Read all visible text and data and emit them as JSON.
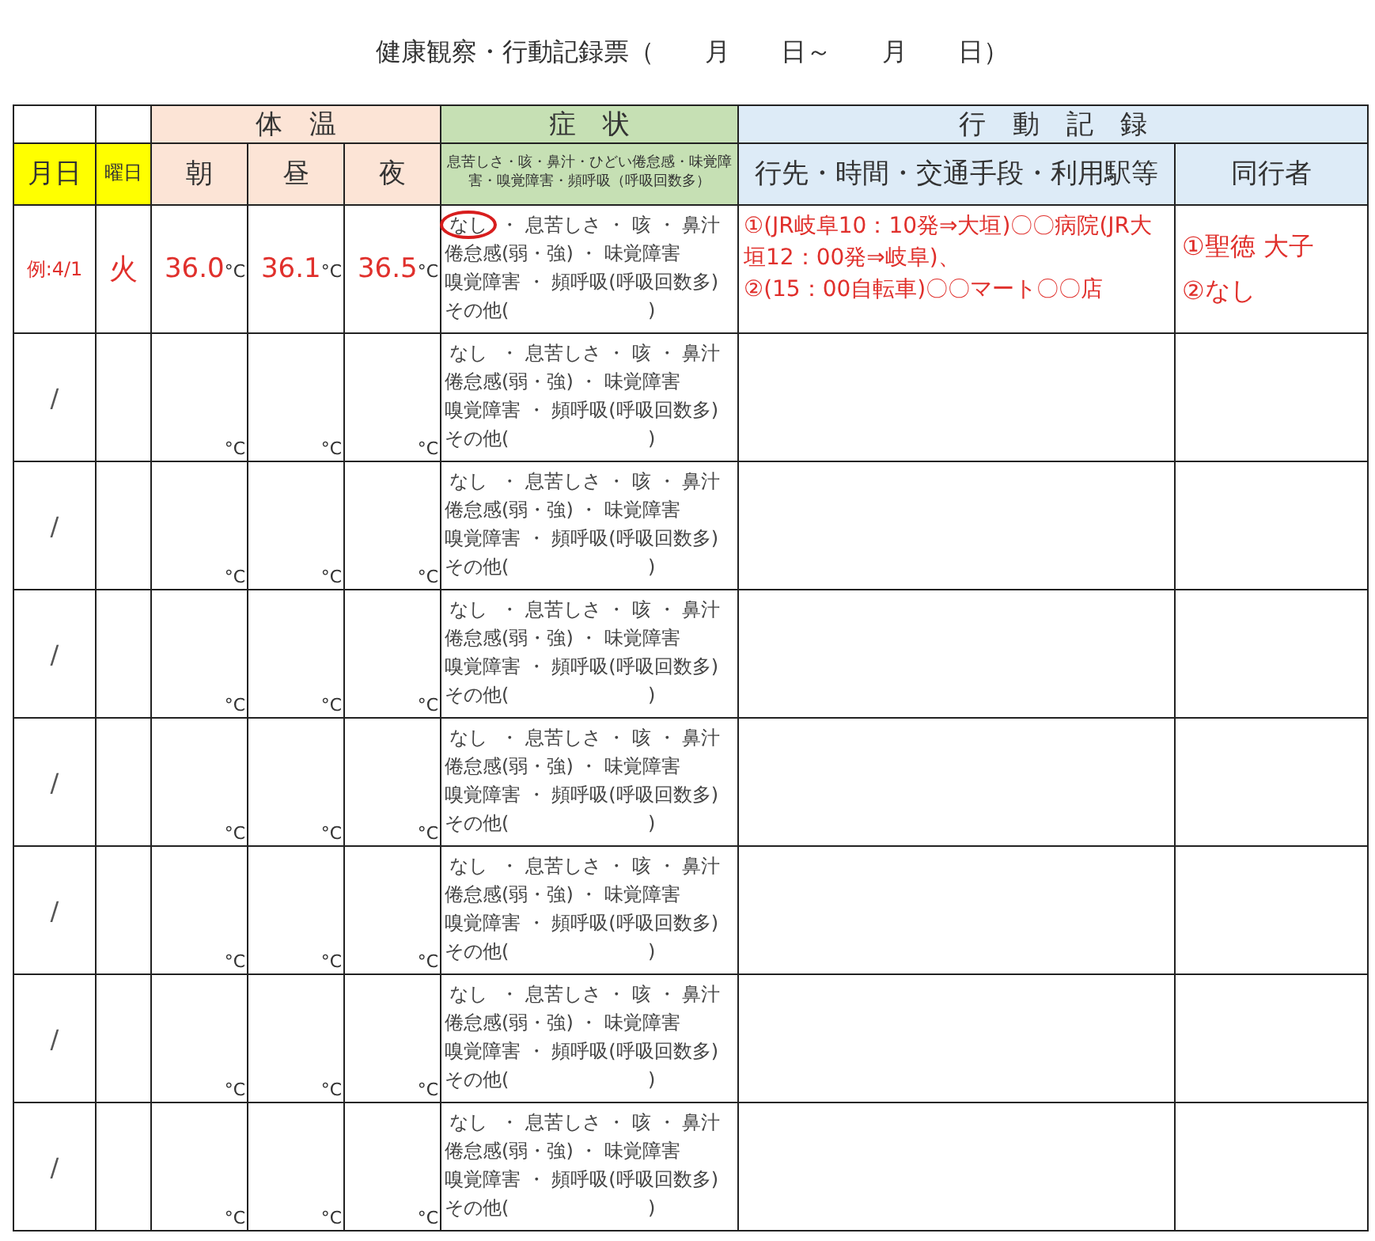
{
  "title": "健康観察・行動記録票（　　月　　日～　　月　　日）",
  "column_groups": [
    {
      "kind": "temperature",
      "label": "体　温"
    },
    {
      "kind": "symptoms",
      "label": "症　状"
    },
    {
      "kind": "activity",
      "label": "行　動　記　録"
    }
  ],
  "columns": [
    {
      "kind": "date",
      "label": "月日"
    },
    {
      "kind": "day",
      "label": "曜日"
    },
    {
      "kind": "temperature",
      "label": "朝"
    },
    {
      "kind": "temperature",
      "label": "昼"
    },
    {
      "kind": "temperature",
      "label": "夜"
    },
    {
      "kind": "symptoms",
      "label": "息苦しさ・咳・鼻汁・ひどい倦怠感・味覚障害・嗅覚障害・頻呼吸（呼吸回数多）"
    },
    {
      "kind": "activity",
      "label": "行先・時間・交通手段・利用駅等"
    },
    {
      "kind": "activity",
      "label": "同行者"
    }
  ],
  "rows": [
    {
      "example": true,
      "date": "例:4/1",
      "day": "火",
      "temperatures": [
        {
          "value": "36.0",
          "unit": "°C"
        },
        {
          "value": "36.1",
          "unit": "°C"
        },
        {
          "value": "36.5",
          "unit": "°C"
        }
      ],
      "symptoms": {
        "none_option": {
          "label": "なし",
          "circled": true
        },
        "rest_of_first_line": "・ 息苦しさ ・ 咳 ・ 鼻汁",
        "lines": [
          "倦怠感(弱・強) ・ 味覚障害",
          "嗅覚障害 ・ 頻呼吸(呼吸回数多)",
          "その他(　　　　　　　 )"
        ]
      },
      "activities": [
        "①(JR岐阜10：10発⇒大垣)〇〇病院(JR大垣12：00発⇒岐阜)、",
        "②(15：00自転車)〇〇マート〇〇店"
      ],
      "companions": [
        "①聖徳 大子",
        "②なし"
      ]
    },
    {
      "example": false,
      "date": "/",
      "temperatures": [
        {
          "unit": "°C"
        },
        {
          "unit": "°C"
        },
        {
          "unit": "°C"
        }
      ],
      "symptoms": {
        "none_option": {
          "label": "なし",
          "circled": false
        },
        "rest_of_first_line": "・ 息苦しさ ・ 咳 ・ 鼻汁",
        "lines": [
          "倦怠感(弱・強) ・ 味覚障害",
          "嗅覚障害 ・ 頻呼吸(呼吸回数多)",
          "その他(　　　　　　　 )"
        ]
      }
    },
    {
      "example": false,
      "date": "/",
      "temperatures": [
        {
          "unit": "°C"
        },
        {
          "unit": "°C"
        },
        {
          "unit": "°C"
        }
      ],
      "symptoms": {
        "none_option": {
          "label": "なし",
          "circled": false
        },
        "rest_of_first_line": "・ 息苦しさ ・ 咳 ・ 鼻汁",
        "lines": [
          "倦怠感(弱・強) ・ 味覚障害",
          "嗅覚障害 ・ 頻呼吸(呼吸回数多)",
          "その他(　　　　　　　 )"
        ]
      }
    },
    {
      "example": false,
      "date": "/",
      "temperatures": [
        {
          "unit": "°C"
        },
        {
          "unit": "°C"
        },
        {
          "unit": "°C"
        }
      ],
      "symptoms": {
        "none_option": {
          "label": "なし",
          "circled": false
        },
        "rest_of_first_line": "・ 息苦しさ ・ 咳 ・ 鼻汁",
        "lines": [
          "倦怠感(弱・強) ・ 味覚障害",
          "嗅覚障害 ・ 頻呼吸(呼吸回数多)",
          "その他(　　　　　　　 )"
        ]
      }
    },
    {
      "example": false,
      "date": "/",
      "temperatures": [
        {
          "unit": "°C"
        },
        {
          "unit": "°C"
        },
        {
          "unit": "°C"
        }
      ],
      "symptoms": {
        "none_option": {
          "label": "なし",
          "circled": false
        },
        "rest_of_first_line": "・ 息苦しさ ・ 咳 ・ 鼻汁",
        "lines": [
          "倦怠感(弱・強) ・ 味覚障害",
          "嗅覚障害 ・ 頻呼吸(呼吸回数多)",
          "その他(　　　　　　　 )"
        ]
      }
    },
    {
      "example": false,
      "date": "/",
      "temperatures": [
        {
          "unit": "°C"
        },
        {
          "unit": "°C"
        },
        {
          "unit": "°C"
        }
      ],
      "symptoms": {
        "none_option": {
          "label": "なし",
          "circled": false
        },
        "rest_of_first_line": "・ 息苦しさ ・ 咳 ・ 鼻汁",
        "lines": [
          "倦怠感(弱・強) ・ 味覚障害",
          "嗅覚障害 ・ 頻呼吸(呼吸回数多)",
          "その他(　　　　　　　 )"
        ]
      }
    },
    {
      "example": false,
      "date": "/",
      "temperatures": [
        {
          "unit": "°C"
        },
        {
          "unit": "°C"
        },
        {
          "unit": "°C"
        }
      ],
      "symptoms": {
        "none_option": {
          "label": "なし",
          "circled": false
        },
        "rest_of_first_line": "・ 息苦しさ ・ 咳 ・ 鼻汁",
        "lines": [
          "倦怠感(弱・強) ・ 味覚障害",
          "嗅覚障害 ・ 頻呼吸(呼吸回数多)",
          "その他(　　　　　　　 )"
        ]
      }
    },
    {
      "example": false,
      "date": "/",
      "temperatures": [
        {
          "unit": "°C"
        },
        {
          "unit": "°C"
        },
        {
          "unit": "°C"
        }
      ],
      "symptoms": {
        "none_option": {
          "label": "なし",
          "circled": false
        },
        "rest_of_first_line": "・ 息苦しさ ・ 咳 ・ 鼻汁",
        "lines": [
          "倦怠感(弱・強) ・ 味覚障害",
          "嗅覚障害 ・ 頻呼吸(呼吸回数多)",
          "その他(　　　　　　　 )"
        ]
      }
    }
  ]
}
